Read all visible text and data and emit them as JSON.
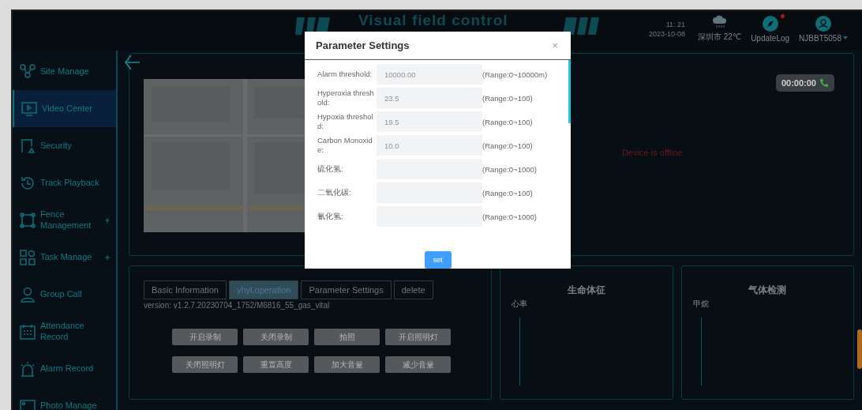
{
  "header": {
    "title": "Visual field control",
    "time": "11: 21",
    "date": "2023-10-08",
    "weather": "深圳市 22℃",
    "update_log": {
      "label": "UpdateLog",
      "unread": true
    },
    "user": "NJBBT5058"
  },
  "sidebar": {
    "items": [
      {
        "label": "Site Manage",
        "selected": false,
        "expandable": false
      },
      {
        "label": "Video Center",
        "selected": true,
        "expandable": false
      },
      {
        "label": "Security",
        "selected": false,
        "expandable": false
      },
      {
        "label": "Track Playback",
        "selected": false,
        "expandable": false
      },
      {
        "label": "Fence Management",
        "selected": false,
        "expandable": true
      },
      {
        "label": "Task Manage",
        "selected": false,
        "expandable": true
      },
      {
        "label": "Group Call",
        "selected": false,
        "expandable": false
      },
      {
        "label": "Attendance Record",
        "selected": false,
        "expandable": false
      },
      {
        "label": "Alarm Record",
        "selected": false,
        "expandable": false
      },
      {
        "label": "Photo Manage",
        "selected": false,
        "expandable": false
      }
    ]
  },
  "video": {
    "timer": "00:00:00",
    "status": "Device is offline"
  },
  "device": {
    "tabs": [
      {
        "label": "Basic Information",
        "selected": false
      },
      {
        "label": "yhyl.operation",
        "selected": true
      },
      {
        "label": "Parameter Settings",
        "selected": false
      },
      {
        "label": "delete",
        "selected": false
      }
    ],
    "version": "version:  v1.2.7.20230704_1752/M6816_55_gas_vital",
    "actions": [
      {
        "label": "开启录制",
        "disabled": true
      },
      {
        "label": "关闭录制",
        "disabled": true
      },
      {
        "label": "拍照",
        "disabled": true
      },
      {
        "label": "开启照明灯",
        "disabled": true
      },
      {
        "label": "关闭照明灯",
        "disabled": true
      },
      {
        "label": "重置高度",
        "disabled": true
      },
      {
        "label": "加大音量",
        "disabled": true
      },
      {
        "label": "减少音量",
        "disabled": true
      }
    ]
  },
  "vitals": {
    "title": "生命体征",
    "axis_label": "心率"
  },
  "gas": {
    "title": "气体检测",
    "axis_label": "甲烷"
  },
  "dialog": {
    "title": "Parameter Settings",
    "close": "×",
    "fields": [
      {
        "label": "Alarm threshold:",
        "placeholder": "10000.00",
        "range": "(Range:0~10000m)"
      },
      {
        "label": "Hyperoxia threshold:",
        "placeholder": "23.5",
        "range": "(Range:0~100)"
      },
      {
        "label": "Hypoxia threshold:",
        "placeholder": "19.5",
        "range": "(Range:0~100)"
      },
      {
        "label": "Carbon Monoxide:",
        "placeholder": "10.0",
        "range": "(Range:0~100)"
      },
      {
        "label": "硫化氢:",
        "range": "(Range:0~1000)"
      },
      {
        "label": "二氧化碳:",
        "range": "(Range:0~100)"
      },
      {
        "label": "氰化氢:",
        "range": "(Range:0~1000)"
      }
    ],
    "submit": "set"
  }
}
